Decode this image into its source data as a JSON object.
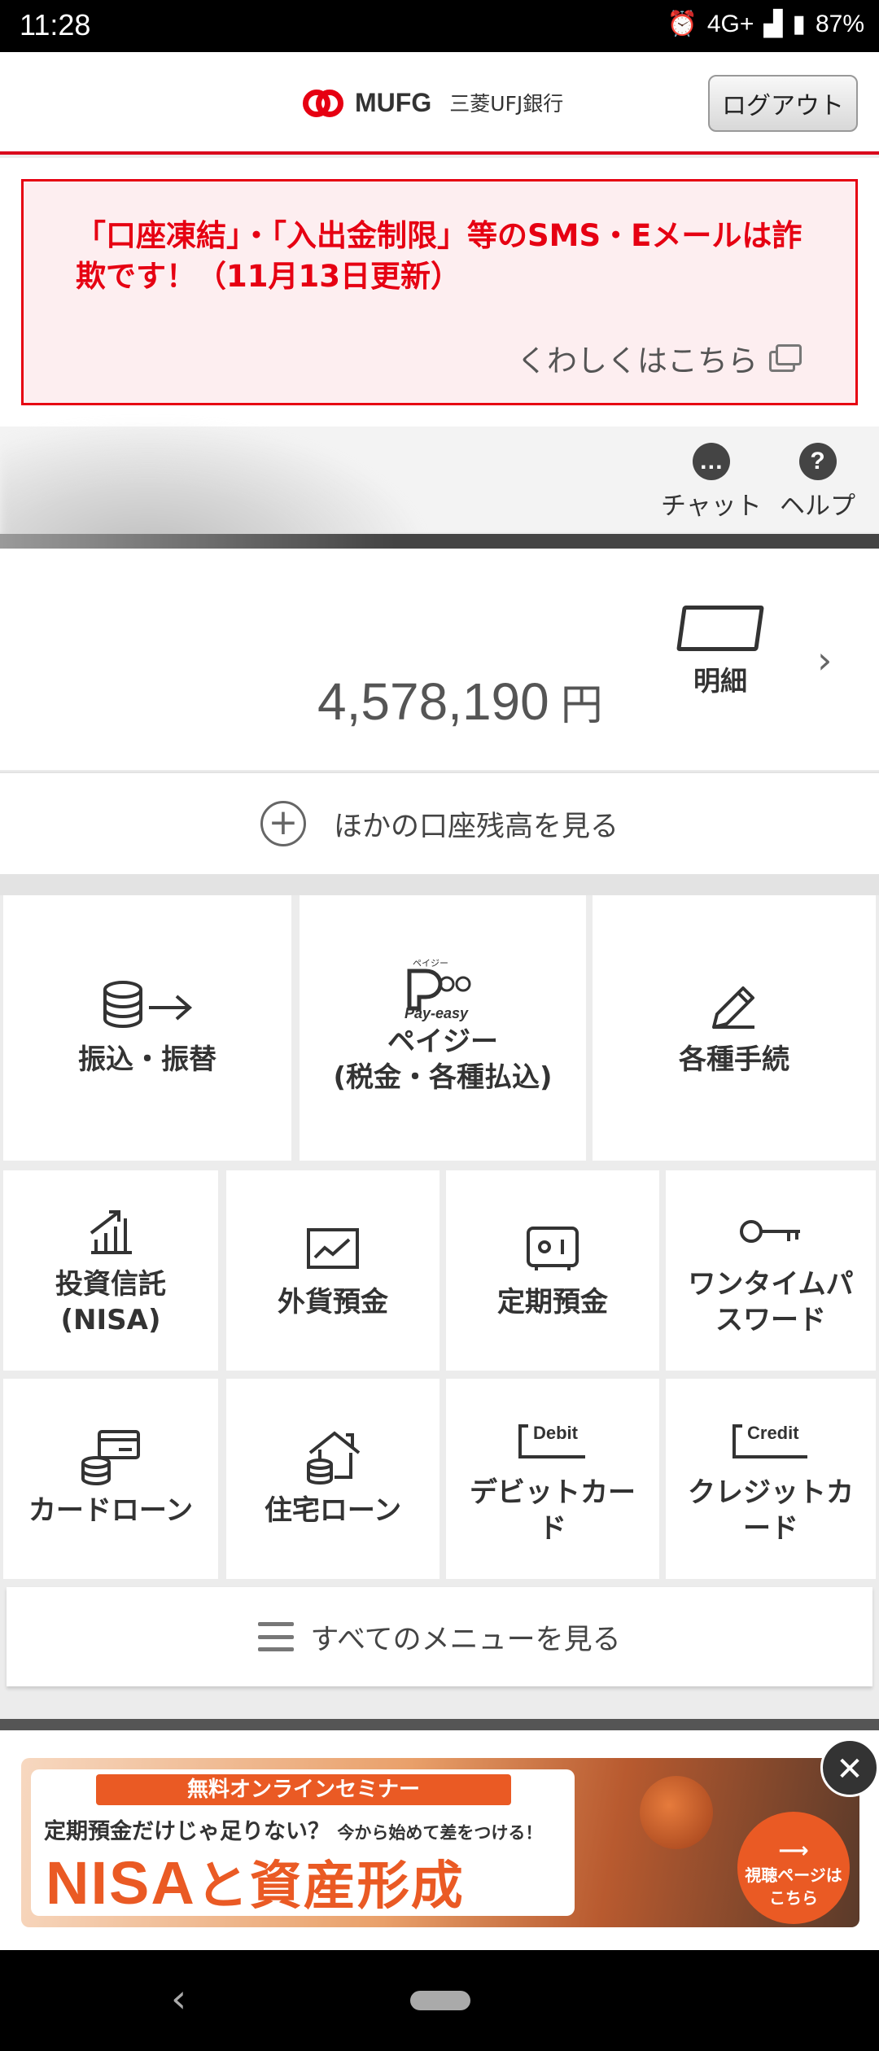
{
  "status_bar": {
    "time": "11:28",
    "network": "4G+",
    "battery": "87%"
  },
  "header": {
    "brand": "MUFG",
    "bank_name": "三菱UFJ銀行",
    "logout_label": "ログアウト"
  },
  "alert": {
    "title": "「口座凍結」・「入出金制限」等のSMS・Eメールは詐欺です！（11月13日更新）",
    "link_label": "くわしくはこちら"
  },
  "tools": {
    "chat_label": "チャット",
    "help_label": "ヘルプ"
  },
  "account": {
    "balance": "4,578,190",
    "currency": "円",
    "detail_label": "明細",
    "other_accounts_label": "ほかの口座残高を見る"
  },
  "menu_large": [
    {
      "label": "振込・振替",
      "icon": "transfer-icon"
    },
    {
      "label": "ペイジー\n(税金・各種払込)",
      "icon": "payeasy-icon",
      "icon_text": "ペイジー",
      "icon_brand": "Pay-easy"
    },
    {
      "label": "各種手続",
      "icon": "pencil-icon"
    }
  ],
  "menu_small": [
    {
      "label": "投資信託\n(NISA)",
      "icon": "investment-chart-icon"
    },
    {
      "label": "外貨預金",
      "icon": "fx-chart-icon"
    },
    {
      "label": "定期預金",
      "icon": "safe-icon"
    },
    {
      "label": "ワンタイムパ\nスワード",
      "icon": "key-icon"
    },
    {
      "label": "カードローン",
      "icon": "card-loan-icon"
    },
    {
      "label": "住宅ローン",
      "icon": "house-loan-icon"
    },
    {
      "label": "デビットカー\nド",
      "icon": "debit-card-icon",
      "icon_text": "Debit"
    },
    {
      "label": "クレジットカ\nード",
      "icon": "credit-card-icon",
      "icon_text": "Credit"
    }
  ],
  "all_menu_label": "すべてのメニューを見る",
  "banner": {
    "pill": "無料オンラインセミナー",
    "sub_main": "定期預金だけじゃ足りない？",
    "sub_small": "今から始めて差をつける！",
    "title_en": "NISA",
    "title_jp": "と資産形成",
    "watch_label": "視聴ページは\nこちら"
  },
  "colors": {
    "accent": "#e60012",
    "banner_orange": "#ea5a24"
  }
}
